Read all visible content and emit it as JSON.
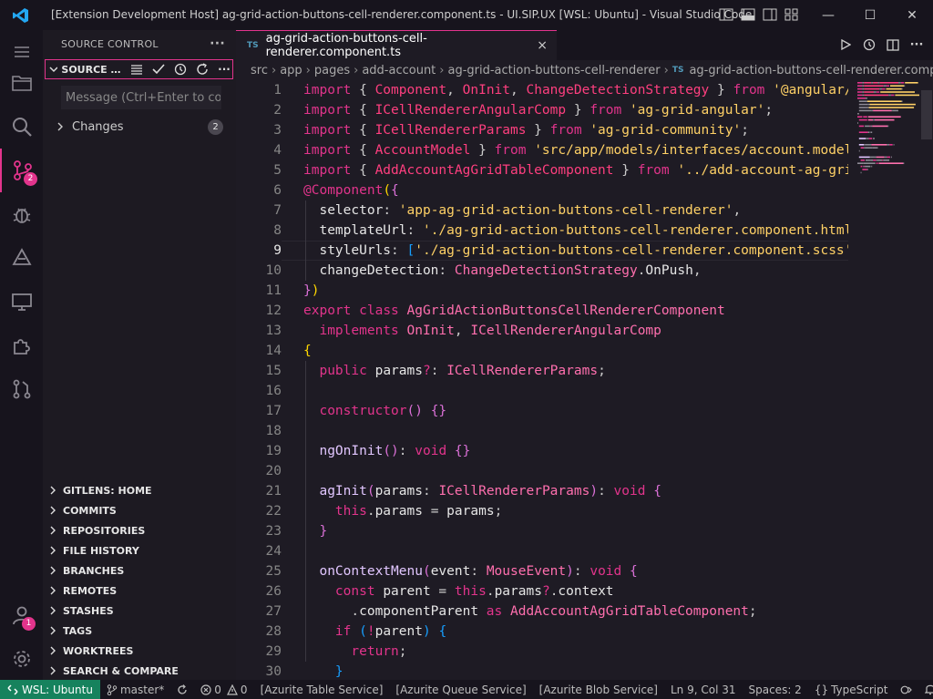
{
  "window": {
    "title": "[Extension Development Host] ag-grid-action-buttons-cell-renderer.component.ts - UI.SIP.UX [WSL: Ubuntu] - Visual Studio Code",
    "min_symbol": "—",
    "max_symbol": "☐",
    "close_symbol": "✕"
  },
  "activity": {
    "scm_badge": "2",
    "accounts_badge": "1"
  },
  "sidebar": {
    "title": "SOURCE CONTROL",
    "more": "···",
    "scm_label": "SOURCE CONTROL",
    "commit_placeholder": "Message (Ctrl+Enter to commit on 'master')",
    "changes_label": "Changes",
    "changes_count": "2",
    "sections": [
      "GITLENS: HOME",
      "COMMITS",
      "REPOSITORIES",
      "FILE HISTORY",
      "BRANCHES",
      "REMOTES",
      "STASHES",
      "TAGS",
      "WORKTREES",
      "SEARCH & COMPARE"
    ]
  },
  "editor": {
    "tab_label": "ag-grid-action-buttons-cell-renderer.component.ts",
    "tab_lang": "TS",
    "close": "×",
    "breadcrumb": [
      "src",
      "app",
      "pages",
      "add-account",
      "ag-grid-action-buttons-cell-renderer"
    ],
    "breadcrumb_file": "ag-grid-action-buttons-cell-renderer.component.ts",
    "current_line": 9,
    "lines": [
      [
        [
          "kw",
          "import"
        ],
        [
          "",
          "{ "
        ],
        [
          "id",
          "Component"
        ],
        [
          "",
          ", "
        ],
        [
          "id",
          "OnInit"
        ],
        [
          "",
          ", "
        ],
        [
          "id",
          "ChangeDetectionStrategy"
        ],
        [
          "",
          " } "
        ],
        [
          "kw",
          "from"
        ],
        [
          "",
          " "
        ],
        [
          "st",
          "'@angular/core';"
        ]
      ],
      [
        [
          "kw",
          "import"
        ],
        [
          "",
          "{ "
        ],
        [
          "id",
          "ICellRendererAngularComp"
        ],
        [
          "",
          " } "
        ],
        [
          "kw",
          "from"
        ],
        [
          "",
          " "
        ],
        [
          "st",
          "'ag-grid-angular'"
        ],
        [
          "",
          ";"
        ]
      ],
      [
        [
          "kw",
          "import"
        ],
        [
          "",
          "{ "
        ],
        [
          "id",
          "ICellRendererParams"
        ],
        [
          "",
          " } "
        ],
        [
          "kw",
          "from"
        ],
        [
          "",
          " "
        ],
        [
          "st",
          "'ag-grid-community'"
        ],
        [
          "",
          ";"
        ]
      ],
      [
        [
          "kw",
          "import"
        ],
        [
          "",
          "{ "
        ],
        [
          "id",
          "AccountModel"
        ],
        [
          "",
          " } "
        ],
        [
          "kw",
          "from"
        ],
        [
          "",
          " "
        ],
        [
          "st",
          "'src/app/models/interfaces/account.model';"
        ]
      ],
      [
        [
          "kw",
          "import"
        ],
        [
          "",
          "{ "
        ],
        [
          "id",
          "AddAccountAgGridTableComponent"
        ],
        [
          "",
          " } "
        ],
        [
          "kw",
          "from"
        ],
        [
          "",
          " "
        ],
        [
          "st",
          "'../add-account-ag-grid-table';"
        ]
      ],
      [
        [
          "kw",
          "@Component"
        ],
        [
          "br",
          "("
        ],
        [
          "br2",
          "{"
        ]
      ],
      [
        [
          "",
          "  "
        ],
        [
          "pr",
          "selector"
        ],
        [
          "",
          ": "
        ],
        [
          "st",
          "'app-ag-grid-action-buttons-cell-renderer'"
        ],
        [
          "",
          ","
        ]
      ],
      [
        [
          "",
          "  "
        ],
        [
          "pr",
          "templateUrl"
        ],
        [
          "",
          ": "
        ],
        [
          "st",
          "'./ag-grid-action-buttons-cell-renderer.component.html',"
        ]
      ],
      [
        [
          "",
          "  "
        ],
        [
          "pr",
          "styleUrls"
        ],
        [
          "",
          ": "
        ],
        [
          "br3",
          "["
        ],
        [
          "st",
          "'./ag-grid-action-buttons-cell-renderer.component.scss'"
        ]
      ],
      [
        [
          "",
          "  "
        ],
        [
          "pr",
          "changeDetection"
        ],
        [
          "",
          ": "
        ],
        [
          "ty",
          "ChangeDetectionStrategy"
        ],
        [
          "",
          "."
        ],
        [
          "pr",
          "OnPush"
        ],
        [
          "",
          ","
        ]
      ],
      [
        [
          "br2",
          "}"
        ],
        [
          "br",
          ")"
        ]
      ],
      [
        [
          "kw",
          "export"
        ],
        [
          "",
          " "
        ],
        [
          "kw",
          "class"
        ],
        [
          "",
          " "
        ],
        [
          "ty",
          "AgGridActionButtonsCellRendererComponent"
        ]
      ],
      [
        [
          "",
          "  "
        ],
        [
          "kw",
          "implements"
        ],
        [
          "",
          " "
        ],
        [
          "ty",
          "OnInit"
        ],
        [
          "",
          ", "
        ],
        [
          "ty",
          "ICellRendererAngularComp"
        ]
      ],
      [
        [
          "br",
          "{"
        ]
      ],
      [
        [
          "",
          "  "
        ],
        [
          "kw",
          "public"
        ],
        [
          "",
          " "
        ],
        [
          "pr",
          "params"
        ],
        [
          "kw",
          "?"
        ],
        [
          "",
          ": "
        ],
        [
          "ty",
          "ICellRendererParams"
        ],
        [
          "",
          ";"
        ]
      ],
      [
        [
          "",
          ""
        ]
      ],
      [
        [
          "",
          "  "
        ],
        [
          "kw",
          "constructor"
        ],
        [
          "br2",
          "()"
        ],
        [
          "",
          " "
        ],
        [
          "br2",
          "{}"
        ]
      ],
      [
        [
          "",
          ""
        ]
      ],
      [
        [
          "",
          "  "
        ],
        [
          "fn",
          "ngOnInit"
        ],
        [
          "br2",
          "()"
        ],
        [
          "",
          ": "
        ],
        [
          "kw",
          "void"
        ],
        [
          "",
          " "
        ],
        [
          "br2",
          "{}"
        ]
      ],
      [
        [
          "",
          ""
        ]
      ],
      [
        [
          "",
          "  "
        ],
        [
          "fn",
          "agInit"
        ],
        [
          "br2",
          "("
        ],
        [
          "pr",
          "params"
        ],
        [
          "",
          ": "
        ],
        [
          "ty",
          "ICellRendererParams"
        ],
        [
          "br2",
          ")"
        ],
        [
          "",
          ": "
        ],
        [
          "kw",
          "void"
        ],
        [
          "",
          " "
        ],
        [
          "br2",
          "{"
        ]
      ],
      [
        [
          "",
          "    "
        ],
        [
          "kw",
          "this"
        ],
        [
          "",
          "."
        ],
        [
          "pr",
          "params"
        ],
        [
          "",
          " = "
        ],
        [
          "pr",
          "params"
        ],
        [
          "",
          ";"
        ]
      ],
      [
        [
          "",
          "  "
        ],
        [
          "br2",
          "}"
        ]
      ],
      [
        [
          "",
          ""
        ]
      ],
      [
        [
          "",
          "  "
        ],
        [
          "fn",
          "onContextMenu"
        ],
        [
          "br2",
          "("
        ],
        [
          "pr",
          "event"
        ],
        [
          "",
          ": "
        ],
        [
          "ty",
          "MouseEvent"
        ],
        [
          "br2",
          ")"
        ],
        [
          "",
          ": "
        ],
        [
          "kw",
          "void"
        ],
        [
          "",
          " "
        ],
        [
          "br2",
          "{"
        ]
      ],
      [
        [
          "",
          "    "
        ],
        [
          "kw",
          "const"
        ],
        [
          "",
          " "
        ],
        [
          "pr",
          "parent"
        ],
        [
          "",
          " = "
        ],
        [
          "kw",
          "this"
        ],
        [
          "",
          "."
        ],
        [
          "pr",
          "params"
        ],
        [
          "kw",
          "?"
        ],
        [
          "",
          "."
        ],
        [
          "pr",
          "context"
        ]
      ],
      [
        [
          "",
          "      ."
        ],
        [
          "pr",
          "componentParent"
        ],
        [
          "",
          " "
        ],
        [
          "kw",
          "as"
        ],
        [
          "",
          " "
        ],
        [
          "ty",
          "AddAccountAgGridTableComponent"
        ],
        [
          "",
          ";"
        ]
      ],
      [
        [
          "",
          "    "
        ],
        [
          "kw",
          "if"
        ],
        [
          "",
          " "
        ],
        [
          "br3",
          "("
        ],
        [
          "kw",
          "!"
        ],
        [
          "pr",
          "parent"
        ],
        [
          "br3",
          ")"
        ],
        [
          "",
          " "
        ],
        [
          "br3",
          "{"
        ]
      ],
      [
        [
          "",
          "      "
        ],
        [
          "kw",
          "return"
        ],
        [
          "",
          ";"
        ]
      ],
      [
        [
          "",
          "    "
        ],
        [
          "br3",
          "}"
        ]
      ]
    ]
  },
  "status": {
    "remote": "WSL: Ubuntu",
    "branch": "master*",
    "errors": "0",
    "warnings": "0",
    "services": [
      "[Azurite Table Service]",
      "[Azurite Queue Service]",
      "[Azurite Blob Service]"
    ],
    "position": "Ln 9, Col 31",
    "spaces": "Spaces: 2",
    "language": "TypeScript"
  },
  "colors": {
    "accent": "#e2348c",
    "remote": "#16825d",
    "background": "#1e1b24"
  }
}
